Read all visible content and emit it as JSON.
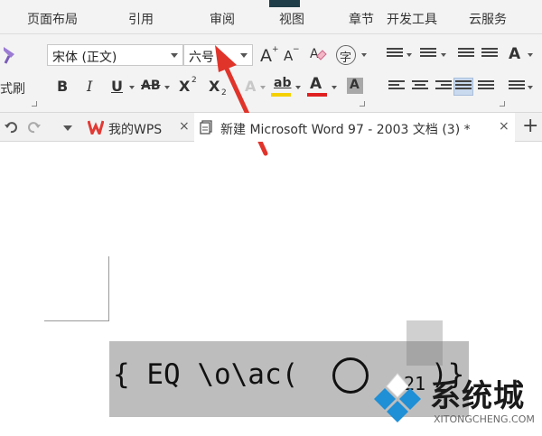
{
  "menu": {
    "tabs": [
      "页面布局",
      "引用",
      "审阅",
      "视图",
      "章节",
      "开发工具",
      "云服务"
    ]
  },
  "ribbon": {
    "format_brush_label": "式刷",
    "font_name": "宋体 (正文)",
    "font_size": "六号",
    "grow_font": "A",
    "shrink_font": "A",
    "bold": "B",
    "italic": "I",
    "underline": "U",
    "strikethrough": "AB",
    "superscript": "X",
    "subscript": "X",
    "char_border": "字",
    "font_color": "A",
    "char_shading": "A",
    "highlight": "ab",
    "text_effect": "A"
  },
  "tabs": {
    "wps_tab": "我的WPS",
    "doc_tab": "新建 Microsoft Word 97 - 2003 文档 (3) *",
    "close": "×",
    "new_tab": "+"
  },
  "document": {
    "field_code": "{ EQ \\o\\ac(",
    "field_number": "21",
    "field_end": ")}"
  },
  "watermark": {
    "title": "系统城",
    "subtitle": "XITONGCHENG.COM"
  },
  "colors": {
    "wps_red": "#e23a35",
    "arrow_red": "#e0342b",
    "highlight_yellow": "#f5d000",
    "font_red": "#e02020",
    "watermark_blue": "#1f8fd6"
  }
}
